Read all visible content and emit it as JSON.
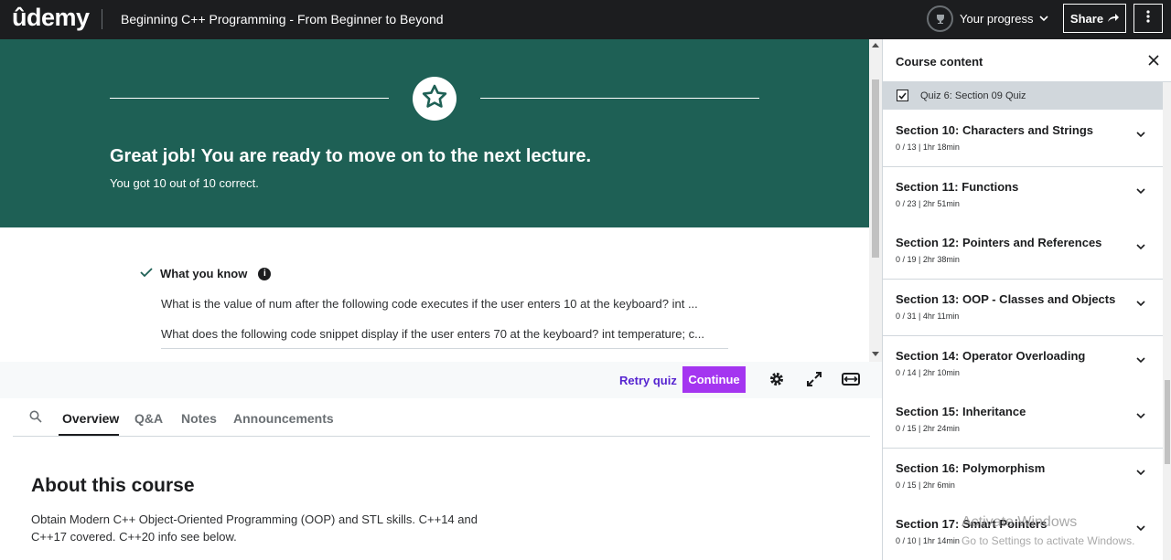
{
  "header": {
    "logo": "ûdemy",
    "course_title": "Beginning C++ Programming - From Beginner to Beyond",
    "progress_label": "Your progress",
    "share_label": "Share"
  },
  "banner": {
    "title": "Great job! You are ready to move on to the next lecture.",
    "subtitle": "You got 10 out of 10 correct."
  },
  "what_you_know": {
    "heading": "What you know",
    "info": "i",
    "questions": [
      "What is the value of num  after the following code executes if the user enters 10  at the keyboard? int ...",
      "What does the following code snippet display if the user enters 70  at the keyboard? int temperature; c..."
    ]
  },
  "controls": {
    "retry_label": "Retry quiz",
    "continue_label": "Continue"
  },
  "tabs": [
    "Overview",
    "Q&A",
    "Notes",
    "Announcements"
  ],
  "about": {
    "title": "About this course",
    "body": "Obtain Modern C++ Object-Oriented Programming (OOP) and STL skills. C++14 and C++17 covered. C++20 info see below."
  },
  "sidebar": {
    "title": "Course content",
    "quiz_item": "Quiz 6: Section 09 Quiz",
    "sections": [
      {
        "title": "Section 10: Characters and Strings",
        "meta": "0 / 13 | 1hr 18min"
      },
      {
        "title": "Section 11: Functions",
        "meta": "0 / 23 | 2hr 51min"
      },
      {
        "title": "Section 12: Pointers and References",
        "meta": "0 / 19 | 2hr 38min"
      },
      {
        "title": "Section 13: OOP - Classes and Objects",
        "meta": "0 / 31 | 4hr 11min"
      },
      {
        "title": "Section 14: Operator Overloading",
        "meta": "0 / 14 | 2hr 10min"
      },
      {
        "title": "Section 15: Inheritance",
        "meta": "0 / 15 | 2hr 24min"
      },
      {
        "title": "Section 16: Polymorphism",
        "meta": "0 / 15 | 2hr 6min"
      },
      {
        "title": "Section 17: Smart Pointers",
        "meta": "0 / 10 | 1hr 14min"
      }
    ]
  },
  "watermark": {
    "line1": "Activate Windows",
    "line2": "Go to Settings to activate Windows."
  },
  "colors": {
    "banner": "#1e6055",
    "accent": "#a435f0",
    "retry": "#5624d0",
    "topbar": "#1c1d1f"
  }
}
